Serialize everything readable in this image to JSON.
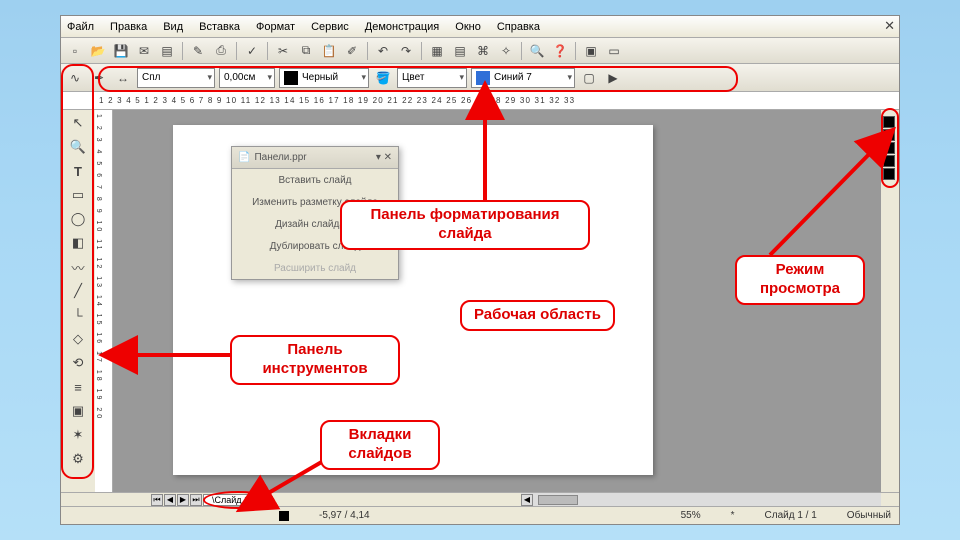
{
  "menu": {
    "items": [
      "Файл",
      "Правка",
      "Вид",
      "Вставка",
      "Формат",
      "Сервис",
      "Демонстрация",
      "Окно",
      "Справка"
    ]
  },
  "format": {
    "linestyle": "Спл",
    "width": "0,00см",
    "color": "Черный",
    "fill_label": "Цвет",
    "fill_color": "Синий 7"
  },
  "ruler_h": "1  2  3  4  5  1  2  3  4  5  6  7  8  9  10 11 12 13 14 15 16 17 18 19 20 21 22 23 24 25 26 27 28 29 30 31 32 33",
  "ruler_v": "1 2 3 4 5 6 7 8 9 10 11 12 13 14 15 16 17 18 19 20",
  "ctx": {
    "title": "Панели.ppr",
    "items": [
      "Вставить слайд",
      "Изменить разметку слайда",
      "Дизайн слайда…",
      "Дублировать слайд",
      "Расширить слайд"
    ]
  },
  "tab": {
    "label": "Слайд 1"
  },
  "status": {
    "pos": "-5,97 / 4,14",
    "zoom": "55%",
    "slide": "Слайд 1 / 1",
    "mode": "Обычный"
  },
  "callouts": {
    "format": "Панель форматирования слайда",
    "tools": "Панель инструментов",
    "work": "Рабочая область",
    "tabs": "Вкладки слайдов",
    "view": "Режим просмотра"
  }
}
